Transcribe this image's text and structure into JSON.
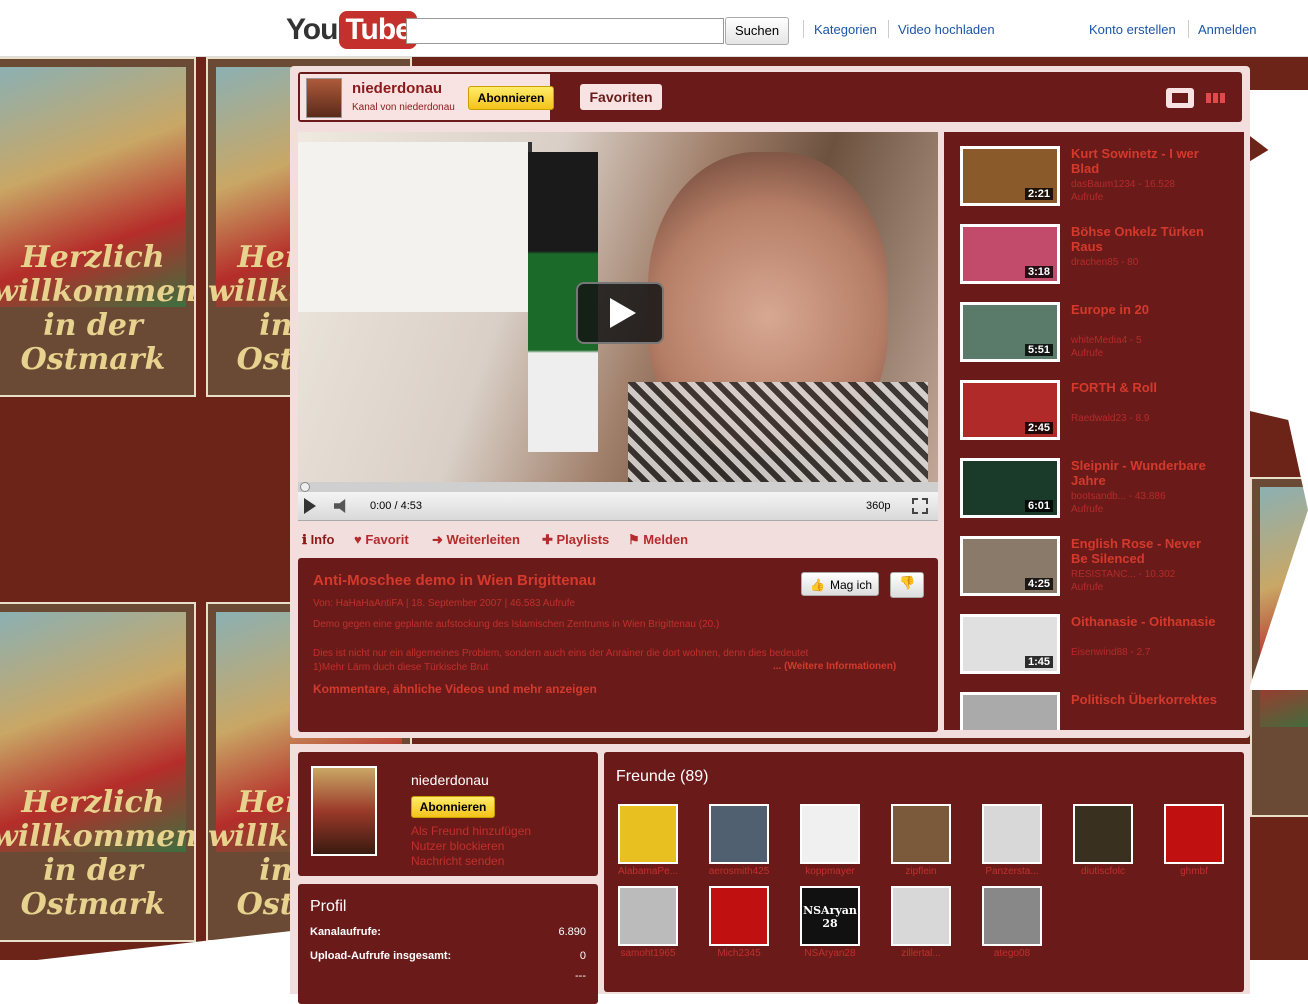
{
  "header": {
    "logo_you": "You",
    "logo_tube": "Tube",
    "search_placeholder": "",
    "search_button": "Suchen",
    "links": [
      "Kategorien",
      "Video hochladen",
      "Konto erstellen",
      "Anmelden"
    ]
  },
  "channel": {
    "name": "niederdonau",
    "subtitle": "Kanal von niederdonau",
    "subscribe": "Abonnieren",
    "tab": "Favoriten"
  },
  "player": {
    "time": "0:00 / 4:53",
    "quality": "360p",
    "progress_fraction": 0.0
  },
  "actions": [
    "Info",
    "Favorit",
    "Weiterleiten",
    "Playlists",
    "Melden"
  ],
  "video": {
    "title": "Anti-Moschee demo in Wien Brigittenau",
    "meta": "Von: HaHaHaAntiFA | 18. September 2007 | 46.583 Aufrufe",
    "description": "Demo gegen eine geplante aufstockung des Islamischen Zentrums in Wien Brigittenau (20.)",
    "description2": "Dies ist nicht nur ein allgemeines Problem, sondern auch eins der Anrainer die dort wohnen, denn dies bedeutet",
    "description3": "1)Mehr Lärm duch diese Türkische Brut",
    "more_info": "... (Weitere Informationen)",
    "show_more": "Kommentare, ähnliche Videos und mehr anzeigen",
    "like": "Mag ich"
  },
  "playlist": [
    {
      "title": "Kurt Sowinetz - I wer Blad",
      "meta": "dasBaum1234 - 16.528",
      "meta2": "Aufrufe",
      "duration": "2:21",
      "color": "#8a5a2a"
    },
    {
      "title": "Böhse Onkelz Türken Raus",
      "meta": "drachen85 - 80",
      "meta2": "",
      "duration": "3:18",
      "color": "#c24a6a"
    },
    {
      "title": "Europe in 20",
      "meta": "whiteMedia4 - 5",
      "meta2": "Aufrufe",
      "duration": "5:51",
      "color": "#5a7a6a"
    },
    {
      "title": "FORTH & Roll",
      "meta": "Raedwald23 - 8.9",
      "meta2": "",
      "duration": "2:45",
      "color": "#b02a2a"
    },
    {
      "title": "Sleipnir - Wunderbare Jahre",
      "meta": "bootsandb... - 43.886",
      "meta2": "Aufrufe",
      "duration": "6:01",
      "color": "#1a3a2a"
    },
    {
      "title": "English Rose - Never Be Silenced",
      "meta": "RESISTANC... - 10.302",
      "meta2": "Aufrufe",
      "duration": "4:25",
      "color": "#8a7a6a"
    },
    {
      "title": "Oithanasie - Oithanasie",
      "meta": "Eisenwind88 - 2.7",
      "meta2": "",
      "duration": "1:45",
      "color": "#e0e0e0"
    },
    {
      "title": "Politisch Überkorrektes",
      "meta": "",
      "meta2": "",
      "duration": "",
      "color": "#aaaaaa"
    }
  ],
  "profile_card": {
    "name": "niederdonau",
    "subscribe": "Abonnieren",
    "links": [
      "Als Freund hinzufügen",
      "Nutzer blockieren",
      "Nachricht senden"
    ]
  },
  "profile": {
    "title": "Profil",
    "rows": [
      {
        "label": "Kanalaufrufe:",
        "value": "6.890"
      },
      {
        "label": "Upload-Aufrufe insgesamt:",
        "value": "0"
      },
      {
        "label": "",
        "value": "---"
      }
    ]
  },
  "friends": {
    "title": "Freunde (89)",
    "items": [
      {
        "name": "AlabamaPe...",
        "color": "#e8c020"
      },
      {
        "name": "aerosmith425",
        "color": "#506070"
      },
      {
        "name": "koppmayer",
        "color": "#f0f0f0"
      },
      {
        "name": "zipflein",
        "color": "#7a5a3a"
      },
      {
        "name": "Panzersta...",
        "color": "#d8d8d8"
      },
      {
        "name": "diutiscfolc",
        "color": "#3a3020"
      },
      {
        "name": "ghmbf",
        "color": "#c01010"
      },
      {
        "name": "samoht1965",
        "color": "#bbbbbb"
      },
      {
        "name": "Mich2345",
        "color": "#c01010"
      },
      {
        "name": "NSAryan28",
        "color": "#111111"
      },
      {
        "name": "zillertal...",
        "color": "#d8d8d8"
      },
      {
        "name": "atego08",
        "color": "#888888"
      }
    ],
    "nsaryan_label": "NSAryan 28"
  },
  "background": {
    "tile_text": "Herzlich willkommen in der Ostmark"
  }
}
